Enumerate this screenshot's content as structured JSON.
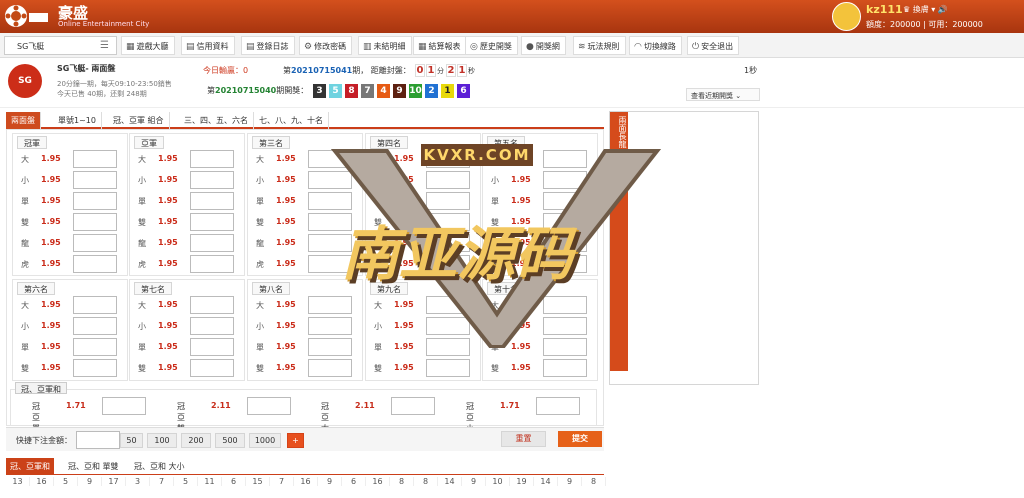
{
  "header": {
    "brand": "豪盛",
    "brand_sub": "Online Entertainment City",
    "username": "kz111",
    "switch_label": "換膚",
    "quota_label": "額度：200000",
    "available_label": "可用：200000"
  },
  "nav": {
    "game_select": "SG飞艇",
    "items": [
      "遊戲大廳",
      "信用資料",
      "登錄日誌",
      "修改密碼",
      "未結明細",
      "結算報表",
      "歷史開獎",
      "開獎網",
      "玩法規則",
      "切換線路",
      "安全退出"
    ]
  },
  "game": {
    "title": "SG飞艇- 兩面盤",
    "line1": "20分鐘一期，每天09:10-23:50銷售",
    "line2": "今天已售 40期，还剩 248期",
    "today": "今日輸贏：0",
    "issue_prefix": "第",
    "issue": "20210715041",
    "issue_suffix": "期，",
    "countdown_label": "距離封盤：",
    "countdown": [
      "0",
      "1",
      "2",
      "1"
    ],
    "unit_min": "分",
    "unit_sec": "秒",
    "seconds": "1秒",
    "last_prefix": "第",
    "last_issue": "20210715040",
    "last_suffix": "期開獎：",
    "balls": [
      "3",
      "5",
      "8",
      "7",
      "4",
      "9",
      "10",
      "2",
      "1",
      "6"
    ],
    "ball_colors": [
      "#333333",
      "#6fd3e0",
      "#c51e27",
      "#777777",
      "#e65b14",
      "#5d2010",
      "#2b9e31",
      "#2071d3",
      "#e8d90a",
      "#5b1fd6"
    ],
    "history_button": "查看近期開獎"
  },
  "tabs": [
    "兩面盤",
    "單號1~10",
    "冠、亞軍 組合",
    "三、四、五、六名",
    "七、八、九、十名"
  ],
  "rank_groups": [
    {
      "title": "冠軍",
      "rows": [
        [
          "大",
          "1.95"
        ],
        [
          "小",
          "1.95"
        ],
        [
          "單",
          "1.95"
        ],
        [
          "雙",
          "1.95"
        ],
        [
          "龍",
          "1.95"
        ],
        [
          "虎",
          "1.95"
        ]
      ]
    },
    {
      "title": "亞軍",
      "rows": [
        [
          "大",
          "1.95"
        ],
        [
          "小",
          "1.95"
        ],
        [
          "單",
          "1.95"
        ],
        [
          "雙",
          "1.95"
        ],
        [
          "龍",
          "1.95"
        ],
        [
          "虎",
          "1.95"
        ]
      ]
    },
    {
      "title": "第三名",
      "rows": [
        [
          "大",
          "1.95"
        ],
        [
          "小",
          "1.95"
        ],
        [
          "單",
          "1.95"
        ],
        [
          "雙",
          "1.95"
        ],
        [
          "龍",
          "1.95"
        ],
        [
          "虎",
          "1.95"
        ]
      ]
    },
    {
      "title": "第四名",
      "rows": [
        [
          "大",
          "1.95"
        ],
        [
          "小",
          "1.95"
        ],
        [
          "單",
          "1.95"
        ],
        [
          "雙",
          "1.95"
        ],
        [
          "龍",
          "1.95"
        ],
        [
          "虎",
          "1.95"
        ]
      ]
    },
    {
      "title": "第五名",
      "rows": [
        [
          "大",
          "1.95"
        ],
        [
          "小",
          "1.95"
        ],
        [
          "單",
          "1.95"
        ],
        [
          "雙",
          "1.95"
        ],
        [
          "龍",
          "1.95"
        ],
        [
          "虎",
          "1.95"
        ]
      ]
    },
    {
      "title": "第六名",
      "rows": [
        [
          "大",
          "1.95"
        ],
        [
          "小",
          "1.95"
        ],
        [
          "單",
          "1.95"
        ],
        [
          "雙",
          "1.95"
        ]
      ]
    },
    {
      "title": "第七名",
      "rows": [
        [
          "大",
          "1.95"
        ],
        [
          "小",
          "1.95"
        ],
        [
          "單",
          "1.95"
        ],
        [
          "雙",
          "1.95"
        ]
      ]
    },
    {
      "title": "第八名",
      "rows": [
        [
          "大",
          "1.95"
        ],
        [
          "小",
          "1.95"
        ],
        [
          "單",
          "1.95"
        ],
        [
          "雙",
          "1.95"
        ]
      ]
    },
    {
      "title": "第九名",
      "rows": [
        [
          "大",
          "1.95"
        ],
        [
          "小",
          "1.95"
        ],
        [
          "單",
          "1.95"
        ],
        [
          "雙",
          "1.95"
        ]
      ]
    },
    {
      "title": "第十名",
      "rows": [
        [
          "大",
          "1.95"
        ],
        [
          "小",
          "1.95"
        ],
        [
          "單",
          "1.95"
        ],
        [
          "雙",
          "1.95"
        ]
      ]
    }
  ],
  "sum_section": {
    "title": "冠、亞軍和",
    "items": [
      [
        "冠亞單",
        "1.71"
      ],
      [
        "冠亞雙",
        "2.11"
      ],
      [
        "冠亞大",
        "2.11"
      ],
      [
        "冠亞小",
        "1.71"
      ]
    ]
  },
  "quick": {
    "label": "快捷下注金額：",
    "amounts": [
      "50",
      "100",
      "200",
      "500",
      "1000",
      "+"
    ],
    "reset": "重置",
    "submit": "提交"
  },
  "bottom_tabs": [
    "冠、亞軍和",
    "冠、亞和 單雙",
    "冠、亞和 大小"
  ],
  "bottom_numbers": [
    "13",
    "16",
    "5",
    "9",
    "17",
    "3",
    "7",
    "5",
    "11",
    "6",
    "15",
    "7",
    "16",
    "9",
    "6",
    "16",
    "8",
    "8",
    "14",
    "9",
    "10",
    "19",
    "14",
    "9",
    "8"
  ],
  "side": {
    "tab": "兩面長龍"
  },
  "watermark": {
    "domain": "KVXR.COM",
    "title": "南亚源码"
  }
}
